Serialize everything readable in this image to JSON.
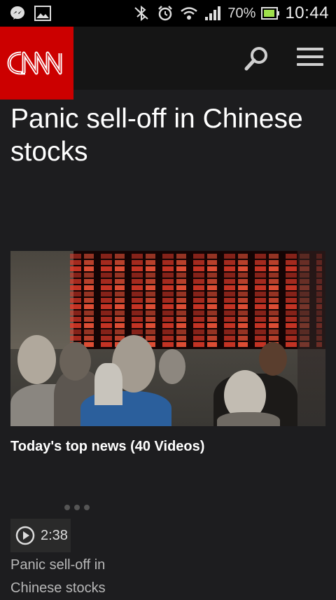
{
  "status_bar": {
    "battery_percent": "70%",
    "time": "10:44",
    "icons": [
      "messenger-icon",
      "gallery-icon",
      "bluetooth-off-icon",
      "alarm-icon",
      "wifi-icon",
      "signal-icon",
      "battery-icon"
    ]
  },
  "app_bar": {
    "logo_text": "CNN",
    "icons": [
      "search-icon",
      "menu-icon"
    ]
  },
  "article": {
    "headline": "Panic sell-off in Chinese stocks"
  },
  "videos_section": {
    "title": "Today's top news (40 Videos)",
    "items": [
      {
        "duration": "2:38",
        "caption": "Panic sell-off in Chinese stocks"
      }
    ]
  },
  "colors": {
    "brand_red": "#cc0000",
    "background": "#1d1d1f",
    "appbar": "#151515"
  }
}
